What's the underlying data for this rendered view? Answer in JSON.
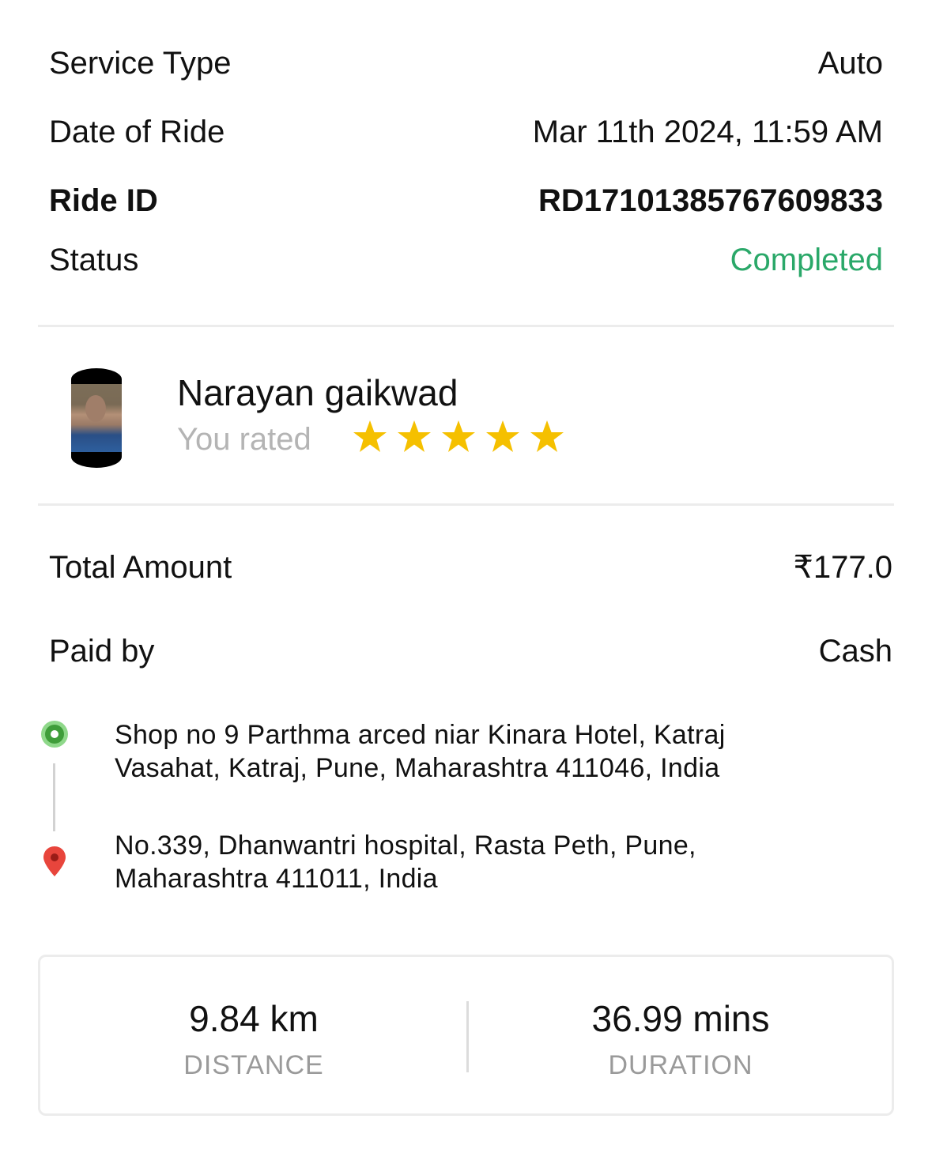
{
  "ride": {
    "service_type": {
      "label": "Service Type",
      "value": "Auto"
    },
    "date": {
      "label": "Date of Ride",
      "value": "Mar 11th 2024, 11:59 AM"
    },
    "ride_id": {
      "label": "Ride ID",
      "value": "RD17101385767609833"
    },
    "status": {
      "label": "Status",
      "value": "Completed",
      "color": "#2aa869"
    }
  },
  "driver": {
    "name": "Narayan gaikwad",
    "rated_label": "You rated",
    "rating": 5,
    "rating_max": 5,
    "star_color": "#f5c000"
  },
  "fare": {
    "total": {
      "label": "Total Amount",
      "value": "₹177.0"
    },
    "paid_by": {
      "label": "Paid by",
      "value": "Cash"
    }
  },
  "route": {
    "pickup_icon": "green-dot-icon",
    "drop_icon": "red-pin-icon",
    "pickup_address": "Shop no 9 Parthma arced niar Kinara Hotel, Katraj Vasahat, Katraj, Pune, Maharashtra 411046, India",
    "drop_address": "No.339, Dhanwantri hospital, Rasta Peth, Pune, Maharashtra 411011, India"
  },
  "stats": {
    "distance": {
      "value": "9.84 km",
      "label": "DISTANCE"
    },
    "duration": {
      "value": "36.99 mins",
      "label": "DURATION"
    }
  }
}
